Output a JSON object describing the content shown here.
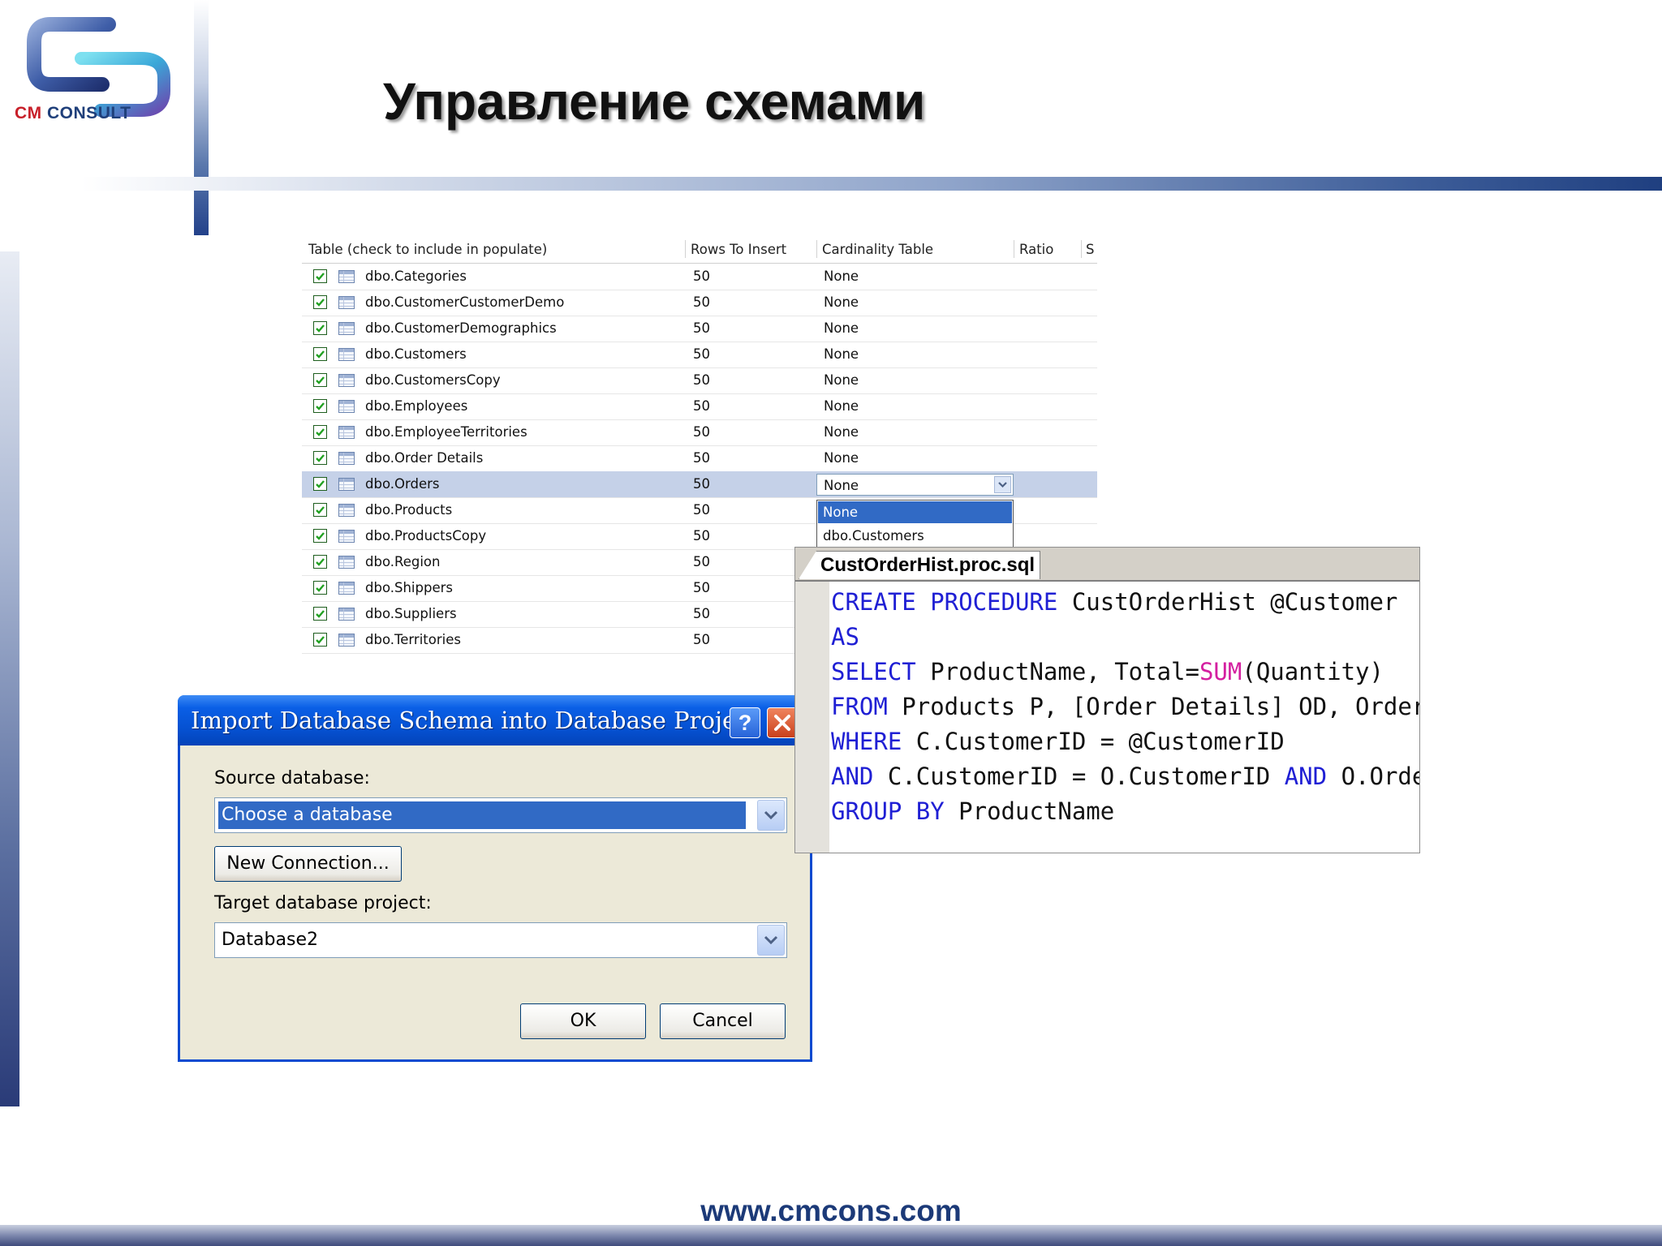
{
  "slide": {
    "title": "Управление схемами",
    "website": "www.cmcons.com",
    "logo": {
      "text_cm": "CM",
      "text_consult": "CONSULT",
      "icon": "cm-consult-logo"
    }
  },
  "populate_grid": {
    "headers": [
      "Table (check to include in populate)",
      "Rows To Insert",
      "Cardinality Table",
      "Ratio",
      "S"
    ],
    "rows": [
      {
        "name": "dbo.Categories",
        "rows": "50",
        "cardinality": "None"
      },
      {
        "name": "dbo.CustomerCustomerDemo",
        "rows": "50",
        "cardinality": "None"
      },
      {
        "name": "dbo.CustomerDemographics",
        "rows": "50",
        "cardinality": "None"
      },
      {
        "name": "dbo.Customers",
        "rows": "50",
        "cardinality": "None"
      },
      {
        "name": "dbo.CustomersCopy",
        "rows": "50",
        "cardinality": "None"
      },
      {
        "name": "dbo.Employees",
        "rows": "50",
        "cardinality": "None"
      },
      {
        "name": "dbo.EmployeeTerritories",
        "rows": "50",
        "cardinality": "None"
      },
      {
        "name": "dbo.Order Details",
        "rows": "50",
        "cardinality": "None"
      },
      {
        "name": "dbo.Orders",
        "rows": "50",
        "cardinality": "None"
      },
      {
        "name": "dbo.Products",
        "rows": "50",
        "cardinality": ""
      },
      {
        "name": "dbo.ProductsCopy",
        "rows": "50",
        "cardinality": ""
      },
      {
        "name": "dbo.Region",
        "rows": "50",
        "cardinality": ""
      },
      {
        "name": "dbo.Shippers",
        "rows": "50",
        "cardinality": ""
      },
      {
        "name": "dbo.Suppliers",
        "rows": "50",
        "cardinality": ""
      },
      {
        "name": "dbo.Territories",
        "rows": "50",
        "cardinality": ""
      }
    ],
    "selected_row": 8,
    "cardinality_dropdown": {
      "value": "None",
      "options": [
        "None",
        "dbo.Customers"
      ]
    }
  },
  "sql_editor": {
    "tab": "CustOrderHist.proc.sql",
    "lines": [
      [
        {
          "t": "CREATE PROCEDURE",
          "k": "kw"
        },
        {
          "t": " CustOrderHist @Customer",
          "k": ""
        }
      ],
      [
        {
          "t": "AS",
          "k": "kw"
        }
      ],
      [
        {
          "t": "SELECT",
          "k": "kw"
        },
        {
          "t": " ProductName, Total=",
          "k": ""
        },
        {
          "t": "SUM",
          "k": "fn"
        },
        {
          "t": "(Quantity)",
          "k": ""
        }
      ],
      [
        {
          "t": "FROM",
          "k": "kw"
        },
        {
          "t": " Products P, [Order Details] OD, Orders O",
          "k": ""
        }
      ],
      [
        {
          "t": "WHERE",
          "k": "kw"
        },
        {
          "t": " C.CustomerID = @CustomerID",
          "k": ""
        }
      ],
      [
        {
          "t": "AND",
          "k": "kw"
        },
        {
          "t": " C.CustomerID = O.CustomerID ",
          "k": ""
        },
        {
          "t": "AND",
          "k": "kw"
        },
        {
          "t": " O.OrderID",
          "k": ""
        }
      ],
      [
        {
          "t": "GROUP BY",
          "k": "kw"
        },
        {
          "t": " ProductName",
          "k": ""
        }
      ]
    ]
  },
  "import_dialog": {
    "title": "Import Database Schema into Database Project",
    "help": "?",
    "source_label": "Source database:",
    "source_value": "Choose a database",
    "new_connection": "New Connection...",
    "target_label": "Target database project:",
    "target_value": "Database2",
    "ok": "OK",
    "cancel": "Cancel"
  },
  "colors": {
    "title_blue": "#0550d0",
    "selection": "#316ac5",
    "keyword": "#1f1fd4",
    "function": "#d420a0"
  }
}
